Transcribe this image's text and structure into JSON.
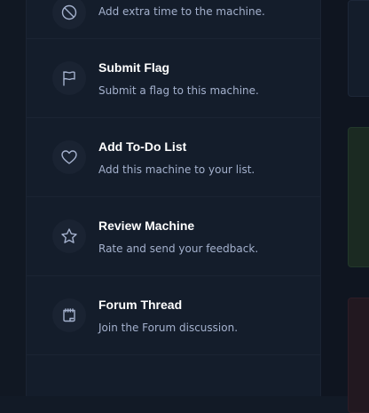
{
  "actions": [
    {
      "title": "",
      "description": "Add extra time to the machine.",
      "icon": "clock-icon"
    },
    {
      "title": "Submit Flag",
      "description": "Submit a flag to this machine.",
      "icon": "flag-icon"
    },
    {
      "title": "Add To-Do List",
      "description": "Add this machine to your list.",
      "icon": "heart-icon"
    },
    {
      "title": "Review Machine",
      "description": "Rate and send your feedback.",
      "icon": "star-icon"
    },
    {
      "title": "Forum Thread",
      "description": "Join the Forum discussion.",
      "icon": "forum-icon"
    }
  ],
  "colors": {
    "background": "#121a26",
    "panel": "#141d2b",
    "text_primary": "#ffffff",
    "text_secondary": "#a4b1cd",
    "accent_green": "#1b2a22",
    "accent_red": "#221820"
  }
}
